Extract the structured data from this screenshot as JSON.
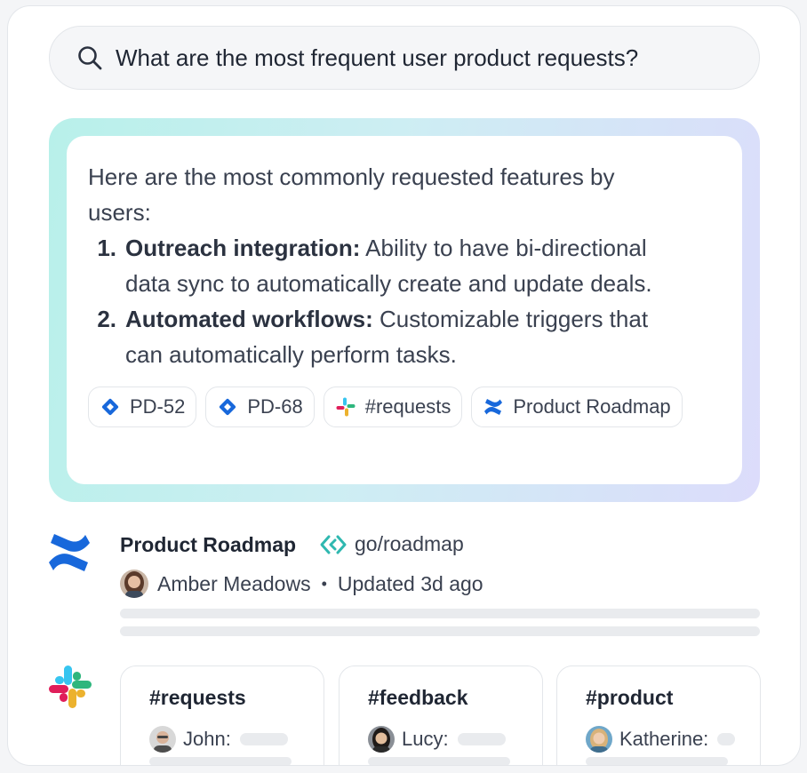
{
  "search": {
    "icon": "search-icon",
    "query": "What are the most frequent user product requests?"
  },
  "answer": {
    "intro": "Here are the most commonly requested features by users:",
    "items": [
      {
        "num": "1.",
        "title": "Outreach integration:",
        "text": " Ability to have bi-directional data sync to automatically create and update deals."
      },
      {
        "num": "2.",
        "title": "Automated workflows:",
        "text": " Customizable triggers that can automatically perform tasks."
      }
    ],
    "sources": [
      {
        "icon": "jira-icon",
        "label": "PD-52"
      },
      {
        "icon": "jira-icon",
        "label": "PD-68"
      },
      {
        "icon": "slack-icon",
        "label": "#requests"
      },
      {
        "icon": "confluence-icon",
        "label": "Product Roadmap"
      }
    ]
  },
  "result": {
    "icon": "confluence-logo-icon",
    "title": "Product Roadmap",
    "golink_icon": "golink-icon",
    "golink": "go/roadmap",
    "author": "Amber Meadows",
    "separator": "•",
    "updated": "Updated 3d ago"
  },
  "slack": {
    "icon": "slack-logo-icon",
    "channels": [
      {
        "name": "#requests",
        "user": "John:"
      },
      {
        "name": "#feedback",
        "user": "Lucy:"
      },
      {
        "name": "#product",
        "user": "Katherine:"
      }
    ]
  },
  "colors": {
    "jira_blue": "#1868db",
    "confluence_blue": "#1868db",
    "golink_teal": "#2fb8b0",
    "slack_blue": "#36c5f0",
    "slack_green": "#2eb67d",
    "slack_red": "#e01e5a",
    "slack_yellow": "#ecb22e"
  }
}
